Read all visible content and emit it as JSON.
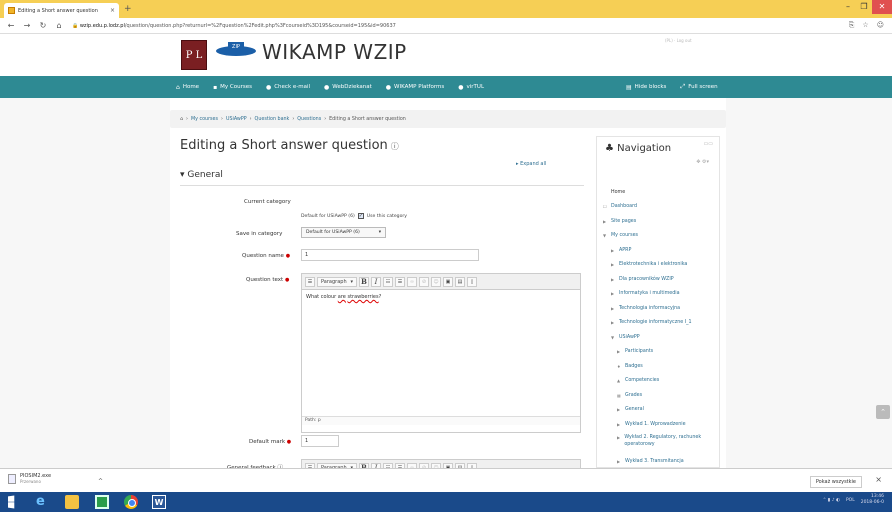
{
  "browser": {
    "tab_title": "Editing a Short answer question",
    "tab_close": "×",
    "new_tab": "+",
    "url_domain": "wzip.edu.p.lodz.pl",
    "url_path": "/question/question.php?returnurl=%2Fquestion%2Fedit.php%3Fcourseid%3D195&courseid=195&id=90637",
    "min": "–",
    "max": "❐",
    "close": "✕"
  },
  "header": {
    "pl_logo_text": "P L",
    "zip_logo_text": "ZIP",
    "site_title": "WIKAMP WZIP",
    "right_text": "(PL) · Log out"
  },
  "navbar": {
    "left": [
      {
        "icon": "home-icon",
        "glyph": "⌂",
        "label": "Home"
      },
      {
        "icon": "courses-icon",
        "glyph": "▪",
        "label": "My Courses"
      },
      {
        "icon": "email-icon",
        "glyph": "●",
        "label": "Check e-mail"
      },
      {
        "icon": "dziekanat-icon",
        "glyph": "●",
        "label": "WebDziekanat"
      },
      {
        "icon": "platforms-icon",
        "glyph": "●",
        "label": "WIKAMP Platforms"
      },
      {
        "icon": "virtul-icon",
        "glyph": "●",
        "label": "virTUL"
      }
    ],
    "hide_blocks": "Hide blocks",
    "full_screen": "Full screen"
  },
  "breadcrumb": [
    "My courses",
    "USiAwPP",
    "Question bank",
    "Questions",
    "Editing a Short answer question"
  ],
  "main": {
    "title": "Editing a Short answer question",
    "expand_all": "Expand all",
    "section_general": "General",
    "current_category_label": "Current category",
    "current_category_value": "Default for USiAwPP (6)",
    "use_category_label": "Use this category",
    "save_category_label": "Save in category",
    "save_category_value": "Default for USiAwPP (6)",
    "question_name_label": "Question name",
    "question_name_value": "1",
    "question_text_label": "Question text",
    "paragraph_label": "Paragraph",
    "question_text_before": "What colour ",
    "question_text_are": "are",
    "question_text_space": " ",
    "question_text_straw": "strawberries",
    "question_text_after": "?",
    "path_label": "Path: p",
    "default_mark_label": "Default mark",
    "default_mark_value": "1",
    "general_feedback_label": "General feedback",
    "required_mark": "●"
  },
  "navigation": {
    "title": "Navigation",
    "items": [
      {
        "label": "Home",
        "arrow": ""
      },
      {
        "label": "Dashboard",
        "arrow": "☐"
      },
      {
        "label": "Site pages",
        "arrow": "▶"
      },
      {
        "label": "My courses",
        "arrow": "▼"
      },
      {
        "label": "APRP",
        "arrow": "▶"
      },
      {
        "label": "Elektrotechnika i elektronika",
        "arrow": "▶"
      },
      {
        "label": "Dla pracowników WZIP",
        "arrow": "▶"
      },
      {
        "label": "Informatyka i multimedia",
        "arrow": "▶"
      },
      {
        "label": "Technologia informacyjna",
        "arrow": "▶"
      },
      {
        "label": "Technologie informatyczne I_1",
        "arrow": "▶"
      },
      {
        "label": "USiAwPP",
        "arrow": "▼"
      },
      {
        "label": "Participants",
        "arrow": "▶"
      },
      {
        "label": "Badges",
        "arrow": "♦"
      },
      {
        "label": "Competencies",
        "arrow": "▲"
      },
      {
        "label": "Grades",
        "arrow": "▦"
      },
      {
        "label": "General",
        "arrow": "▶"
      },
      {
        "label": "Wykład 1. Wprowadzenie",
        "arrow": "▶"
      },
      {
        "label": "Wykład 2. Regulatory, rachunek operatorowy",
        "arrow": "▶"
      },
      {
        "label": "Wykład 3. Transmitancja",
        "arrow": "▶"
      }
    ]
  },
  "downloads": {
    "file": "PIOSIM2.exe",
    "status": "Przerwano",
    "show_all": "Pokaż wszystkie"
  },
  "taskbar": {
    "lang": "POL",
    "time": "13:46",
    "date": "2018-06-0"
  }
}
